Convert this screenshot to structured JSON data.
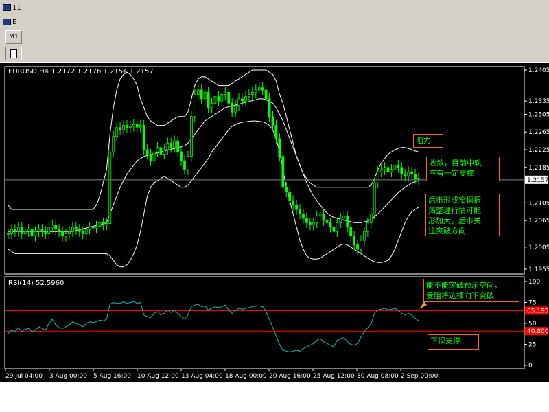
{
  "window": {
    "title_fragment": "11",
    "subwindow_fragment": "E",
    "timeframe_button": "M1"
  },
  "chart_data": {
    "type": "line",
    "symbol_header": "EURUSD,H4  1.2172 1.2176 1.2154 1.2157",
    "price_axis": {
      "ticks": [
        "1.2405",
        "1.2335",
        "1.2305",
        "1.2265",
        "1.2225",
        "1.2185",
        "1.2105",
        "1.2065",
        "1.2005",
        "1.1955"
      ],
      "tick_values": [
        1.2405,
        1.2335,
        1.2305,
        1.2265,
        1.2225,
        1.2185,
        1.2105,
        1.2065,
        1.2005,
        1.1955
      ],
      "ylim": [
        1.1955,
        1.2405
      ],
      "current_price_label": "1.2157",
      "current_price": 1.2157
    },
    "x_ticks": [
      "29 Jul 04:00",
      "3 Aug 00:00",
      "5 Aug 16:00",
      "10 Aug 12:00",
      "13 Aug 04:00",
      "18 Aug 00:00",
      "20 Aug 16:00",
      "25 Aug 12:00",
      "30 Aug 08:00",
      "2 Sep 00:00"
    ],
    "price_series": [
      1.2035,
      1.2045,
      1.204,
      1.205,
      1.2035,
      1.204,
      1.2045,
      1.203,
      1.204,
      1.2045,
      1.204,
      1.2035,
      1.205,
      1.2055,
      1.2045,
      1.204,
      1.203,
      1.2035,
      1.204,
      1.205,
      1.2045,
      1.204,
      1.2035,
      1.2045,
      1.205,
      1.2048,
      1.2052,
      1.206,
      1.2055,
      1.2058,
      1.222,
      1.2255,
      1.2275,
      1.227,
      1.228,
      1.2275,
      1.2278,
      1.2282,
      1.2276,
      1.228,
      1.2225,
      1.2215,
      1.22,
      1.222,
      1.223,
      1.2215,
      1.2225,
      1.224,
      1.223,
      1.2245,
      1.222,
      1.22,
      1.218,
      1.221,
      1.23,
      1.235,
      1.236,
      1.234,
      1.2355,
      1.232,
      1.233,
      1.2345,
      1.2335,
      1.235,
      1.2355,
      1.233,
      1.231,
      1.2325,
      1.234,
      1.2335,
      1.2345,
      1.235,
      1.2355,
      1.236,
      1.2365,
      1.236,
      1.234,
      1.23,
      1.228,
      1.225,
      1.221,
      1.214,
      1.213,
      1.211,
      1.21,
      1.209,
      1.208,
      1.207,
      1.206,
      1.2055,
      1.206,
      1.2075,
      1.208,
      1.2065,
      1.206,
      1.205,
      1.204,
      1.206,
      1.207,
      1.2075,
      1.205,
      1.203,
      1.201,
      1.2,
      1.202,
      1.204,
      1.206,
      1.208,
      1.215,
      1.2175,
      1.218,
      1.2185,
      1.2175,
      1.218,
      1.219,
      1.2185,
      1.217,
      1.2165,
      1.2175,
      1.217,
      1.216,
      1.2157
    ],
    "bollinger": {
      "upper": [
        1.21,
        1.209,
        1.209,
        1.209,
        1.209,
        1.209,
        1.209,
        1.209,
        1.209,
        1.209,
        1.209,
        1.209,
        1.209,
        1.209,
        1.209,
        1.209,
        1.209,
        1.209,
        1.209,
        1.209,
        1.209,
        1.209,
        1.209,
        1.209,
        1.209,
        1.209,
        1.21,
        1.212,
        1.215,
        1.218,
        1.226,
        1.232,
        1.236,
        1.2385,
        1.2395,
        1.24,
        1.2395,
        1.2385,
        1.237,
        1.234,
        1.232,
        1.23,
        1.229,
        1.2285,
        1.228,
        1.228,
        1.228,
        1.2285,
        1.229,
        1.2295,
        1.23,
        1.23,
        1.23,
        1.231,
        1.234,
        1.237,
        1.2385,
        1.239,
        1.239,
        1.2385,
        1.238,
        1.2375,
        1.237,
        1.237,
        1.237,
        1.237,
        1.2375,
        1.238,
        1.2385,
        1.239,
        1.2395,
        1.24,
        1.2405,
        1.2405,
        1.2405,
        1.2405,
        1.2405,
        1.24,
        1.2395,
        1.238,
        1.235,
        1.233,
        1.23,
        1.227,
        1.224,
        1.221,
        1.219,
        1.217,
        1.216,
        1.215,
        1.2145,
        1.214,
        1.214,
        1.214,
        1.214,
        1.214,
        1.214,
        1.214,
        1.214,
        1.214,
        1.214,
        1.214,
        1.214,
        1.214,
        1.214,
        1.214,
        1.214,
        1.2145,
        1.216,
        1.218,
        1.2195,
        1.2205,
        1.2215,
        1.222,
        1.2225,
        1.2228,
        1.223,
        1.223,
        1.2228,
        1.2225,
        1.2222,
        1.222
      ],
      "middle": [
        1.204,
        1.204,
        1.204,
        1.204,
        1.204,
        1.204,
        1.204,
        1.204,
        1.204,
        1.204,
        1.204,
        1.204,
        1.204,
        1.204,
        1.204,
        1.204,
        1.204,
        1.204,
        1.204,
        1.204,
        1.2042,
        1.2044,
        1.2046,
        1.2048,
        1.205,
        1.2052,
        1.2054,
        1.2056,
        1.2058,
        1.206,
        1.208,
        1.21,
        1.212,
        1.214,
        1.2155,
        1.217,
        1.218,
        1.219,
        1.22,
        1.2205,
        1.221,
        1.2212,
        1.2214,
        1.2216,
        1.2218,
        1.222,
        1.2222,
        1.2224,
        1.2226,
        1.2228,
        1.223,
        1.2232,
        1.2234,
        1.224,
        1.225,
        1.226,
        1.227,
        1.228,
        1.229,
        1.2295,
        1.23,
        1.2305,
        1.231,
        1.2315,
        1.232,
        1.2322,
        1.2324,
        1.2326,
        1.2328,
        1.233,
        1.2332,
        1.2334,
        1.2336,
        1.2338,
        1.234,
        1.234,
        1.2338,
        1.2334,
        1.233,
        1.232,
        1.2305,
        1.229,
        1.227,
        1.225,
        1.223,
        1.221,
        1.219,
        1.217,
        1.215,
        1.2135,
        1.212,
        1.211,
        1.21,
        1.209,
        1.2082,
        1.2076,
        1.2072,
        1.207,
        1.2068,
        1.2066,
        1.2064,
        1.2062,
        1.206,
        1.206,
        1.206,
        1.2062,
        1.2064,
        1.2068,
        1.2074,
        1.208,
        1.2088,
        1.2096,
        1.2104,
        1.2112,
        1.212,
        1.2128,
        1.2134,
        1.214,
        1.2145,
        1.215,
        1.2153,
        1.2155
      ],
      "lower": [
        1.2,
        1.1995,
        1.199,
        1.199,
        1.199,
        1.199,
        1.199,
        1.199,
        1.199,
        1.199,
        1.199,
        1.199,
        1.199,
        1.199,
        1.199,
        1.199,
        1.199,
        1.199,
        1.199,
        1.199,
        1.199,
        1.199,
        1.199,
        1.199,
        1.199,
        1.199,
        1.199,
        1.199,
        1.199,
        1.199,
        1.1985,
        1.1975,
        1.1965,
        1.196,
        1.196,
        1.1965,
        1.1975,
        1.199,
        1.201,
        1.204,
        1.208,
        1.212,
        1.214,
        1.215,
        1.2155,
        1.216,
        1.2165,
        1.216,
        1.2155,
        1.215,
        1.2145,
        1.214,
        1.214,
        1.2145,
        1.2155,
        1.2165,
        1.2175,
        1.2185,
        1.2195,
        1.2205,
        1.222,
        1.223,
        1.224,
        1.225,
        1.226,
        1.227,
        1.2278,
        1.2282,
        1.2285,
        1.2287,
        1.2288,
        1.2289,
        1.229,
        1.229,
        1.2289,
        1.2288,
        1.2285,
        1.228,
        1.227,
        1.225,
        1.222,
        1.218,
        1.214,
        1.211,
        1.208,
        1.205,
        1.202,
        1.2,
        1.1985,
        1.198,
        1.1978,
        1.1978,
        1.198,
        1.1985,
        1.199,
        1.1995,
        1.2,
        1.2005,
        1.201,
        1.2012,
        1.201,
        1.2005,
        1.2,
        1.1995,
        1.199,
        1.1985,
        1.198,
        1.1975,
        1.1972,
        1.197,
        1.197,
        1.1972,
        1.1975,
        1.1985,
        1.2,
        1.202,
        1.204,
        1.206,
        1.2075,
        1.2085,
        1.209,
        1.2095
      ]
    },
    "rsi": {
      "header": "RSI(14)  52.5960",
      "ticks": [
        "100",
        "75",
        "50",
        "25",
        "0"
      ],
      "tick_values": [
        100,
        75,
        50,
        25,
        0
      ],
      "upper_level_label": "65.195",
      "upper_level": 65.195,
      "lower_level_label": "40.800",
      "lower_level": 40.8,
      "values": [
        38,
        42,
        40,
        45,
        40,
        43,
        44,
        40,
        42,
        46,
        44,
        42,
        50,
        55,
        48,
        45,
        44,
        46,
        48,
        52,
        50,
        48,
        46,
        50,
        52,
        51,
        52,
        54,
        53,
        55,
        73,
        75,
        74,
        74,
        76,
        74,
        75,
        76,
        74,
        75,
        60,
        58,
        57,
        62,
        64,
        60,
        62,
        66,
        63,
        66,
        62,
        58,
        55,
        60,
        70,
        72,
        73,
        70,
        71,
        66,
        68,
        70,
        69,
        70,
        72,
        66,
        62,
        65,
        68,
        67,
        68,
        69,
        70,
        71,
        71,
        70,
        64,
        55,
        45,
        35,
        25,
        18,
        17,
        16,
        17,
        18,
        17,
        20,
        22,
        24,
        26,
        30,
        32,
        28,
        26,
        24,
        22,
        30,
        32,
        33,
        28,
        25,
        24,
        26,
        34,
        40,
        45,
        50,
        62,
        66,
        67,
        68,
        66,
        67,
        68,
        66,
        62,
        60,
        62,
        60,
        56,
        53
      ]
    }
  },
  "annotations": {
    "resistance": "阻力",
    "support_mid": "收敛，目前中轨\n应有一定支撑",
    "narrow_range": "后市形成窄幅振\n荡整理行情可能\n形加大，后市关\n注突破方向",
    "rsi_note": "能不能突破预示空间，\n受阻将选择向下突破",
    "rsi_support": "下探支撑"
  },
  "colors": {
    "candle": "#00ff00",
    "bands": "#ffffff",
    "rsi_line": "#00c0c0",
    "rsi_levels": "#ff0000",
    "note_border": "#ff6a00",
    "note_text": "#00ff00",
    "arrow": "#ff9933"
  }
}
